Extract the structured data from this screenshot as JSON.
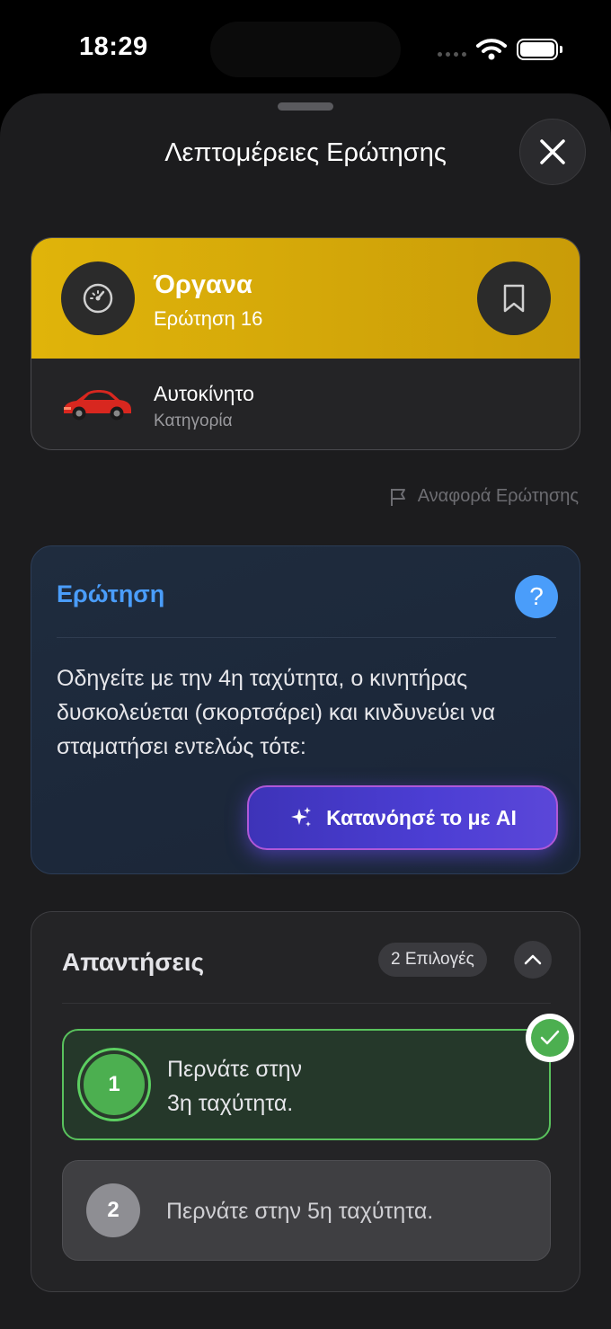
{
  "status": {
    "time": "18:29"
  },
  "sheet": {
    "title": "Λεπτομέρειες Ερώτησης"
  },
  "topic": {
    "title": "Όργανα",
    "subtitle": "Ερώτηση 16",
    "icon": "gauge-icon"
  },
  "category": {
    "name": "Αυτοκίνητο",
    "label": "Κατηγορία",
    "icon": "red-car-icon"
  },
  "report": {
    "label": "Αναφορά Ερώτησης"
  },
  "question": {
    "heading": "Ερώτηση",
    "text": "Οδηγείτε με την 4η ταχύτητα, ο κινητήρας δυσκολεύεται (σκορτσάρει) και κινδυνεύει να σταματήσει εντελώς τότε:",
    "ai_button": "Κατανόησέ το με AI"
  },
  "answers": {
    "title": "Απαντήσεις",
    "count_badge": "2 Επιλογές",
    "items": [
      {
        "number": "1",
        "line1": "Περνάτε στην",
        "line2": "3η ταχύτητα.",
        "correct": true
      },
      {
        "number": "2",
        "text": "Περνάτε στην 5η ταχύτητα.",
        "correct": false
      }
    ]
  },
  "colors": {
    "accent_yellow": "#e0b40a",
    "accent_blue": "#4a9dfa",
    "correct_green": "#4caf50",
    "ai_purple": "#4c3ed4"
  }
}
